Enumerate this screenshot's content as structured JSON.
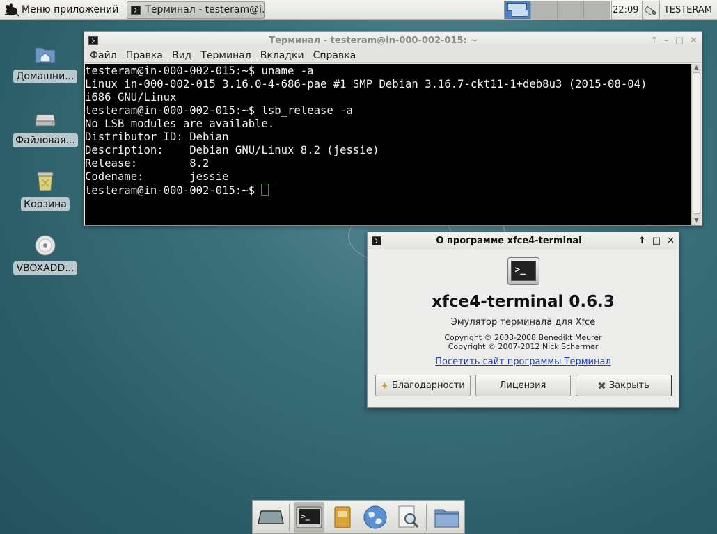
{
  "top_panel": {
    "app_menu_label": "Меню приложений",
    "task_label": "Терминал - testeram@i...",
    "clock": "22:09",
    "user": "TESTERAM"
  },
  "desktop_icons": [
    {
      "label": "Домашни...",
      "icon": "home-folder-icon"
    },
    {
      "label": "Файловая...",
      "icon": "filesystem-drive-icon"
    },
    {
      "label": "Корзина",
      "icon": "trash-icon"
    },
    {
      "label": "VBOXADD...",
      "icon": "cdrom-disc-icon"
    }
  ],
  "terminal": {
    "title": "Терминал - testeram@in-000-002-015: ~",
    "menu": [
      "Файл",
      "Правка",
      "Вид",
      "Терминал",
      "Вкладки",
      "Справка"
    ],
    "lines": [
      "testeram@in-000-002-015:~$ uname -a",
      "Linux in-000-002-015 3.16.0-4-686-pae #1 SMP Debian 3.16.7-ckt11-1+deb8u3 (2015-08-04)",
      "i686 GNU/Linux",
      "testeram@in-000-002-015:~$ lsb_release -a",
      "No LSB modules are available.",
      "Distributor ID: Debian",
      "Description:    Debian GNU/Linux 8.2 (jessie)",
      "Release:        8.2",
      "Codename:       jessie"
    ],
    "prompt": "testeram@in-000-002-015:~$ "
  },
  "about": {
    "title": "О программе xfce4-terminal",
    "name": "xfce4-terminal 0.6.3",
    "description": "Эмулятор терминала для Xfce",
    "copyright1": "Copyright © 2003-2008 Benedikt Meurer",
    "copyright2": "Copyright © 2007-2012 Nick Schermer",
    "link": "Посетить сайт программы Терминал",
    "btn_credits": "Благодарности",
    "btn_license": "Лицензия",
    "btn_close": "Закрыть"
  },
  "colors": {
    "accent_workspace": "#4f7fbe",
    "terminal_bg": "#000000",
    "cursor": "#1fa12a",
    "link": "#1a3fb4"
  },
  "dock_items": [
    "show-desktop-icon",
    "terminal-icon",
    "file-manager-icon",
    "web-browser-icon",
    "app-finder-icon",
    "folder-icon"
  ]
}
